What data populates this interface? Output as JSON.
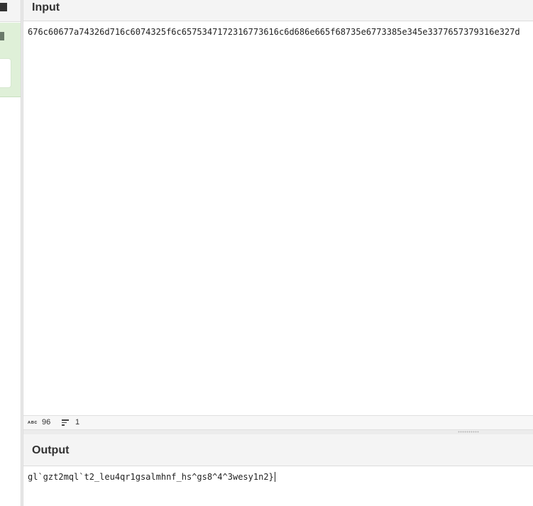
{
  "input": {
    "title": "Input",
    "text": "676c60677a74326d716c6074325f6c6575347172316773616c6d686e665f68735e6773385e345e3377657379316e327d"
  },
  "status": {
    "length": "96",
    "lines": "1"
  },
  "output": {
    "title": "Output",
    "text": "gl`gzt2mql`t2_leu4qr1gsalmhnf_hs^gs8^4^3wesy1n2}"
  },
  "icons": {
    "length": "abc-icon",
    "lines": "lines-icon"
  },
  "colors": {
    "operation_bg": "#dff0d8",
    "header_bg": "#f4f4f4"
  }
}
